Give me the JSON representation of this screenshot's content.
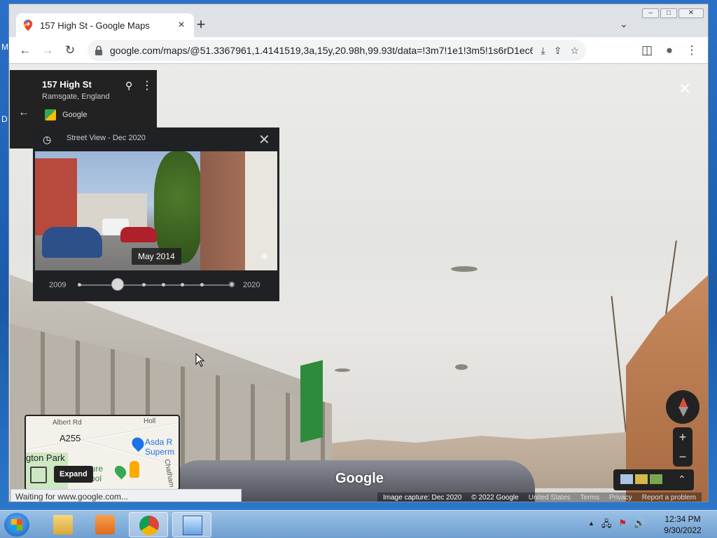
{
  "desktop": {
    "fragment_top": "M",
    "fragment_mid": "D"
  },
  "browser": {
    "tab": {
      "title": "157 High St - Google Maps",
      "close_glyph": "×"
    },
    "new_tab_glyph": "+",
    "tab_search_glyph": "⌄",
    "window": {
      "minimize": "–",
      "maximize": "□",
      "close": "✕"
    },
    "toolbar": {
      "back": "←",
      "forward": "→",
      "reload": "↻",
      "url": "google.com/maps/@51.3367961,1.4141519,3a,15y,20.98h,99.93t/data=!3m7!1e1!3m5!1s6rD1ec67fdY_i...",
      "install_glyph": "⤓",
      "share_glyph": "⇪",
      "bookmark_glyph": "☆",
      "sidepanel_glyph": "◫",
      "profile_glyph": "●",
      "menu_glyph": "⋮"
    },
    "status": "Waiting for www.google.com..."
  },
  "streetview": {
    "close_glyph": "✕",
    "place": {
      "title": "157 High St",
      "subtitle": "Ramsgate, England",
      "source": "Google",
      "back_glyph": "←",
      "pin_glyph": "⚲",
      "more_glyph": "⋮"
    },
    "time_travel": {
      "header": "Street View - Dec 2020",
      "history_glyph": "◷",
      "close_glyph": "✕",
      "preview_date": "May 2014",
      "zoom_glyph": "⊕",
      "start_year": "2009",
      "end_year": "2020",
      "slider_position": 0.25
    },
    "minimap": {
      "roads": [
        "Albert Rd",
        "A255",
        "Holl",
        "Chatham"
      ],
      "park": "gton Park",
      "poi": "Asda R\nSuperm",
      "pool": "isure\nPool",
      "expand_label": "Expand"
    },
    "zoom": {
      "in": "+",
      "out": "−"
    },
    "layers_glyph": "⌃",
    "watermark": "Google",
    "footer": {
      "capture": "Image capture: Dec 2020",
      "copyright": "© 2022 Google",
      "country": "United States",
      "terms": "Terms",
      "privacy": "Privacy",
      "report": "Report a problem"
    }
  },
  "taskbar": {
    "clock_time": "12:34 PM",
    "clock_date": "9/30/2022",
    "tray": {
      "arrow": "▲",
      "network": "🖧",
      "flag": "⚑",
      "volume": "🔊"
    }
  },
  "colors": {
    "accent": "#1a73e8",
    "sv_dark": "#202124",
    "compass_red": "#e04b3b"
  }
}
